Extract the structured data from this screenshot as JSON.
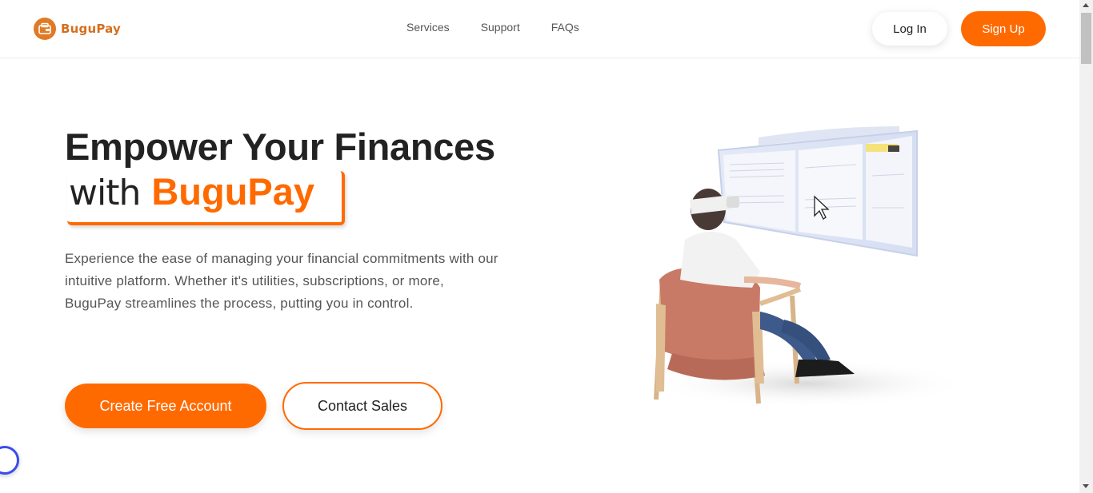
{
  "brand": {
    "name": "BuguPay",
    "accent": "#ff6a00",
    "logo_color": "#e07a25"
  },
  "nav": {
    "items": [
      "Services",
      "Support",
      "FAQs"
    ]
  },
  "auth": {
    "login_label": "Log In",
    "signup_label": "Sign Up"
  },
  "hero": {
    "title_line1": "Empower Your Finances",
    "title_with": "with",
    "title_brand": "BuguPay",
    "description": "Experience the ease of managing your financial commitments with our intuitive platform. Whether it's utilities, subscriptions, or more, BuguPay streamlines the process, putting you in control.",
    "primary_cta": "Create Free Account",
    "secondary_cta": "Contact Sales"
  },
  "icons": {
    "logo": "wallet-icon",
    "chat": "chat-widget-icon",
    "illustration": "vr-headset-woman-chair-illustration"
  }
}
